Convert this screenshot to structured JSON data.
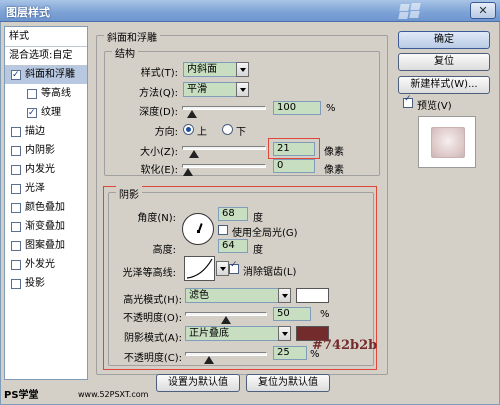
{
  "window": {
    "title": "图层样式"
  },
  "sidebar": {
    "header": "样式",
    "blend_options": "混合选项:自定",
    "items": [
      {
        "label": "斜面和浮雕",
        "checked": true
      },
      {
        "label": "等高线",
        "checked": false
      },
      {
        "label": "纹理",
        "checked": true
      },
      {
        "label": "描边",
        "checked": false
      },
      {
        "label": "内阴影",
        "checked": false
      },
      {
        "label": "内发光",
        "checked": false
      },
      {
        "label": "光泽",
        "checked": false
      },
      {
        "label": "颜色叠加",
        "checked": false
      },
      {
        "label": "渐变叠加",
        "checked": false
      },
      {
        "label": "图案叠加",
        "checked": false
      },
      {
        "label": "外发光",
        "checked": false
      },
      {
        "label": "投影",
        "checked": false
      }
    ]
  },
  "main": {
    "section_title": "斜面和浮雕",
    "structure": {
      "title": "结构",
      "style_label": "样式(T):",
      "style_value": "内斜面",
      "technique_label": "方法(Q):",
      "technique_value": "平滑",
      "depth_label": "深度(D):",
      "depth_value": "100",
      "depth_unit": "%",
      "depth_level": 0.06,
      "direction_label": "方向:",
      "direction_up": "上",
      "direction_down": "下",
      "size_label": "大小(Z):",
      "size_value": "21",
      "size_unit": "像素",
      "size_level": 0.08,
      "soften_label": "软化(E):",
      "soften_value": "0",
      "soften_unit": "像素",
      "soften_level": 0.0
    },
    "shading": {
      "title": "阴影",
      "angle_label": "角度(N):",
      "angle_value": "68",
      "angle_unit": "度",
      "global_light_label": "使用全局光(G)",
      "altitude_label": "高度:",
      "altitude_value": "64",
      "altitude_unit": "度",
      "gloss_contour_label": "光泽等高线:",
      "anti_alias_label": "消除锯齿(L)",
      "highlight_mode_label": "高光模式(H):",
      "highlight_mode_value": "滤色",
      "highlight_color": "#ffffff",
      "highlight_opacity_label": "不透明度(O):",
      "highlight_opacity_value": "50",
      "highlight_opacity_unit": "%",
      "highlight_opacity_level": 0.5,
      "shadow_mode_label": "阴影模式(A):",
      "shadow_mode_value": "正片叠底",
      "shadow_color": "#742b2b",
      "shadow_opacity_label": "不透明度(C):",
      "shadow_opacity_value": "25",
      "shadow_opacity_unit": "%",
      "shadow_opacity_level": 0.25
    },
    "make_default": "设置为默认值",
    "reset_default": "复位为默认值"
  },
  "actions": {
    "ok": "确定",
    "reset": "复位",
    "new_style": "新建样式(W)...",
    "preview_label": "预览(V)"
  },
  "annotation_text": "#742b2b",
  "watermark_left": "PS学堂",
  "watermark_center": "www.52PSXT.com"
}
